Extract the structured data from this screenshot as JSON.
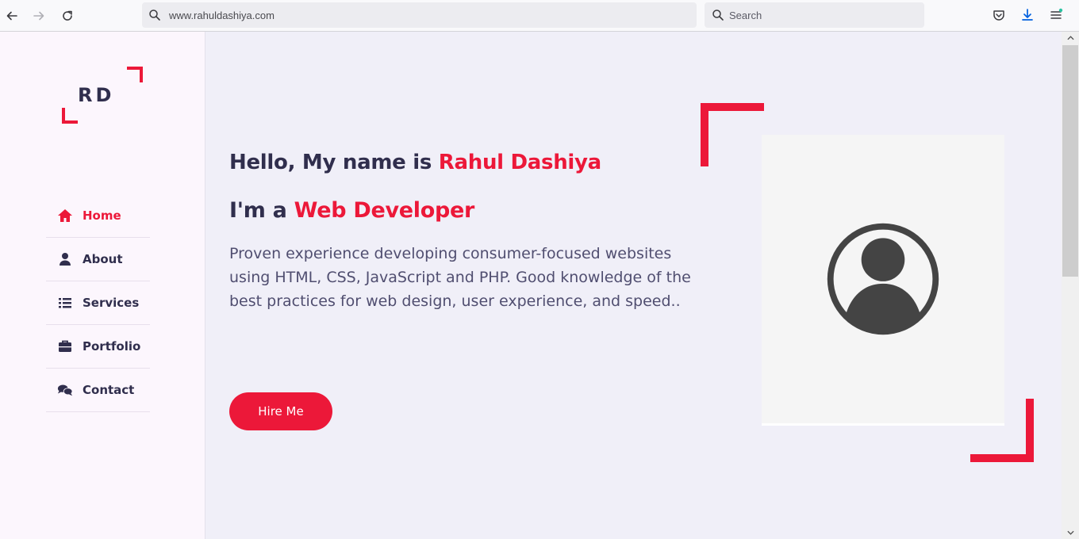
{
  "browser": {
    "url": "www.rahuldashiya.com",
    "search_placeholder": "Search",
    "icons": [
      "back-icon",
      "forward-icon",
      "reload-icon",
      "search-icon",
      "pocket-icon",
      "downloads-icon",
      "menu-icon"
    ]
  },
  "sidebar": {
    "logo_text": "RD",
    "nav": [
      {
        "label": "Home",
        "icon": "home-icon",
        "active": true
      },
      {
        "label": "About",
        "icon": "user-icon",
        "active": false
      },
      {
        "label": "Services",
        "icon": "list-icon",
        "active": false
      },
      {
        "label": "Portfolio",
        "icon": "briefcase-icon",
        "active": false
      },
      {
        "label": "Contact",
        "icon": "comments-icon",
        "active": false
      }
    ]
  },
  "hero": {
    "greeting_prefix": "Hello, My name is ",
    "name": "Rahul Dashiya",
    "role_prefix": "I'm a ",
    "role": "Web Developer",
    "description": "Proven experience developing consumer-focused websites using HTML, CSS, JavaScript and PHP. Good knowledge of the best practices for web design, user experience, and speed..",
    "cta_label": "Hire Me",
    "photo_icon": "user-avatar-icon"
  },
  "colors": {
    "accent": "#ec1839",
    "text_dark": "#302e4d",
    "text_body": "#504e70",
    "sidebar_bg": "#fcf6fd",
    "main_bg": "#f0eff8"
  }
}
